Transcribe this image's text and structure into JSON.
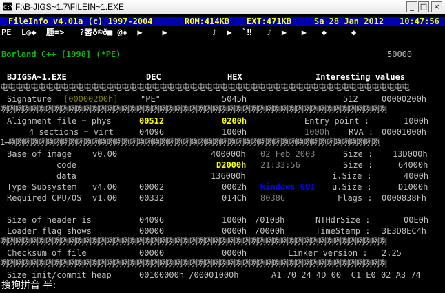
{
  "window": {
    "title": "F:\\B-JIGS~1.7\\FILEIN~1.EXE",
    "icon_label": "C:\\",
    "minimize": "_",
    "maximize": "□",
    "close": "×"
  },
  "infobar": {
    "app": "FileInfo v4.01a (c) 1997-2004",
    "rom": "ROM:414KB",
    "ext": "EXT:471KB",
    "date": "Sa 28 Jan 2012",
    "time": "10:47:56"
  },
  "symbols": "PE  L◎◆  腫=>   ?莕δ©ð■ @◈  ▶    ▶         ♪  ▶  `‼   ♪  ▶   ▶   ◆     ◆",
  "header": {
    "left": "Borland C++ [1998] (*PE)",
    "right": "50000"
  },
  "columns": {
    "file": "BJIGSA~1.EXE",
    "dec": "DEC",
    "hex": "HEX",
    "interesting": "Interesting values"
  },
  "separator": "屯屯屯屯屯屯屯屯屯屯屯屯屯屯屯屯屯屯屯屯屯屯屯屯屯屯屯屯屯屯屯屯屯屯屯屯屯屯屯屯屯屯屯屯屯屯屯屯屯屯屯屯屯屯",
  "separator2": "咧咧咧咧咧咧咧咧咧咧咧咧咧咧咧咧咧咧咧咧咧咧咧咧咧咧咧咧咧咧咧咧咧咧咧咧咧咧咧咧咧咧咧咧咧咧咧咧咧咧咧",
  "separator3": "1→咧咧咧咧咧咧咧咧咧咧咧咧咧咧咧咧咧咧咧咧咧咧咧咧咧咧咧咧咧咧咧咧咧咧咧咧咧咧咧咧咧咧咧咧咧咧咧咧咧",
  "signature": {
    "label": "Signature",
    "value": "[00000200h]",
    "dec": "\"PE\"",
    "hex": "5045h",
    "val1": "512",
    "val2": "00000200h"
  },
  "alignment": {
    "label": "Alignment file = phys",
    "dec": "00512",
    "hex": "0200h",
    "ep_label": "Entry point :",
    "ep_value": "1000h"
  },
  "sections": {
    "label": "4 sections = virt",
    "dec": "04096",
    "hex": "1000h",
    "hex2": "1000h",
    "rva_label": "RVA :",
    "rva_value": "00001000h"
  },
  "base": {
    "label": "Base of image",
    "ver": "v0.00",
    "hex": "400000h",
    "date": "02 Feb 2003",
    "size_label": "Size :",
    "size_value": "13D000h"
  },
  "code": {
    "label": "code",
    "hex": "D2000h",
    "time": "21:33:56",
    "size_label": "Size :",
    "size_value": "64000h"
  },
  "datarow": {
    "label": "data",
    "hex": "136000h",
    "size_label": "i.Size :",
    "size_value": "4000h"
  },
  "subsystem": {
    "label": "Type Subsystem",
    "ver": "v4.00",
    "dec": "00002",
    "hex": "0002h",
    "name": "Windows GUI",
    "size_label": "u.Size :",
    "size_value": "D1000h"
  },
  "cpu": {
    "label": "Required CPU/OS",
    "ver": "v1.00",
    "dec": "00332",
    "hex": "014Ch",
    "cpu": "80386",
    "flags_label": "Flags :",
    "flags_value": "0000838Fh"
  },
  "header_size": {
    "label": "Size of header is",
    "dec": "04096",
    "hex": "1000h",
    "slash": "/010Bh",
    "nt_label": "NTHdrSize :",
    "nt_value": "00E0h"
  },
  "loader": {
    "label": "Loader flag shows",
    "dec": "00000",
    "hex": "0000h",
    "slash": "/0000h",
    "ts_label": "TimeStamp :",
    "ts_value": "3E3D8EC4h"
  },
  "checksum": {
    "label": "Checksum of file",
    "dec": "00000",
    "hex": "0000h",
    "linker_label": "Linker version :",
    "linker_value": "2.25"
  },
  "heap": {
    "label": "Size init/commit heap",
    "values": "00100000h /00001000h",
    "bytes": "A1 70 24 4D 00  C1 E0 02 A3 74"
  },
  "ime": "搜狗拼音 半:"
}
